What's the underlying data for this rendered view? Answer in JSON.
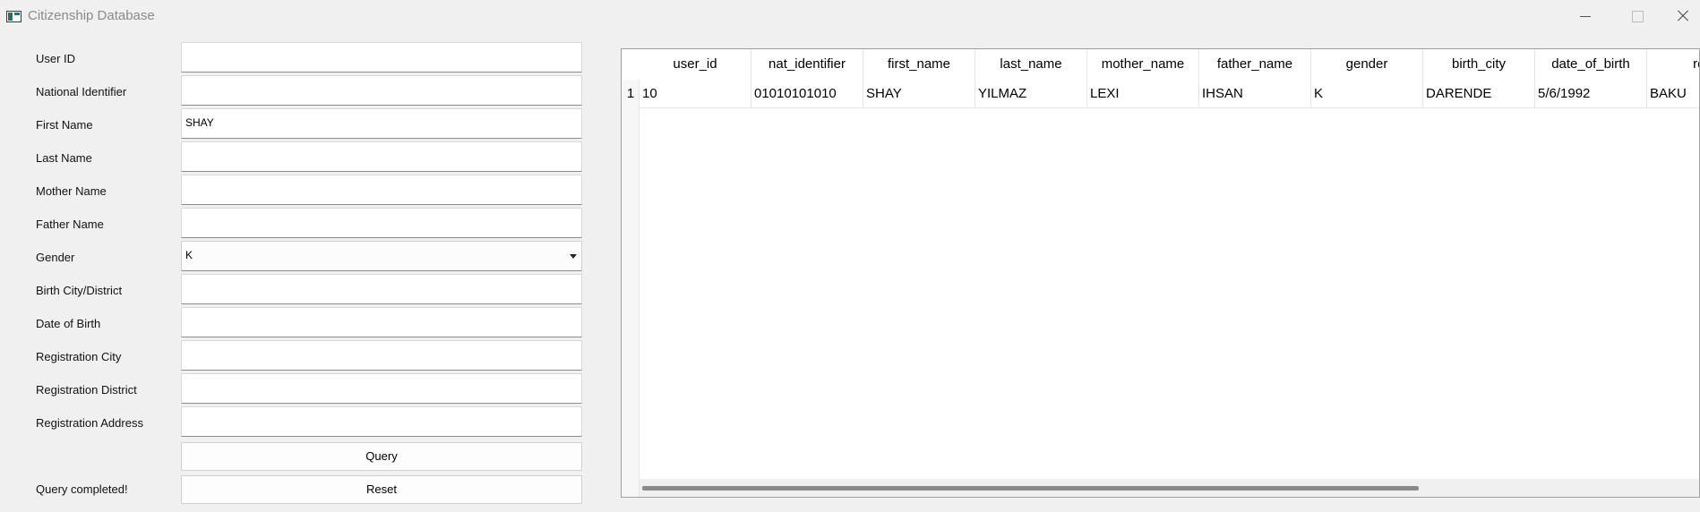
{
  "window": {
    "title": "Citizenship Database"
  },
  "form": {
    "labels": {
      "user_id": "User ID",
      "national_identifier": "National Identifier",
      "first_name": "First Name",
      "last_name": "Last Name",
      "mother_name": "Mother Name",
      "father_name": "Father Name",
      "gender": "Gender",
      "birth_city": "Birth City/District",
      "date_of_birth": "Date of Birth",
      "registration_city": "Registration City",
      "registration_district": "Registration District",
      "registration_address": "Registration Address"
    },
    "values": {
      "user_id": "",
      "national_identifier": "",
      "first_name": "SHAY",
      "last_name": "",
      "mother_name": "",
      "father_name": "",
      "gender": "K",
      "birth_city": "",
      "date_of_birth": "",
      "registration_city": "",
      "registration_district": "",
      "registration_address": ""
    },
    "query_button": "Query",
    "reset_button": "Reset",
    "status": "Query completed!"
  },
  "table": {
    "columns": [
      "user_id",
      "nat_identifier",
      "first_name",
      "last_name",
      "mother_name",
      "father_name",
      "gender",
      "birth_city",
      "date_of_birth",
      "reg"
    ],
    "rows": [
      {
        "number": "1",
        "cells": [
          "10",
          "01010101010",
          "SHAY",
          "YILMAZ",
          "LEXI",
          "IHSAN",
          "K",
          "DARENDE",
          "5/6/1992",
          "BAKU"
        ]
      }
    ]
  }
}
